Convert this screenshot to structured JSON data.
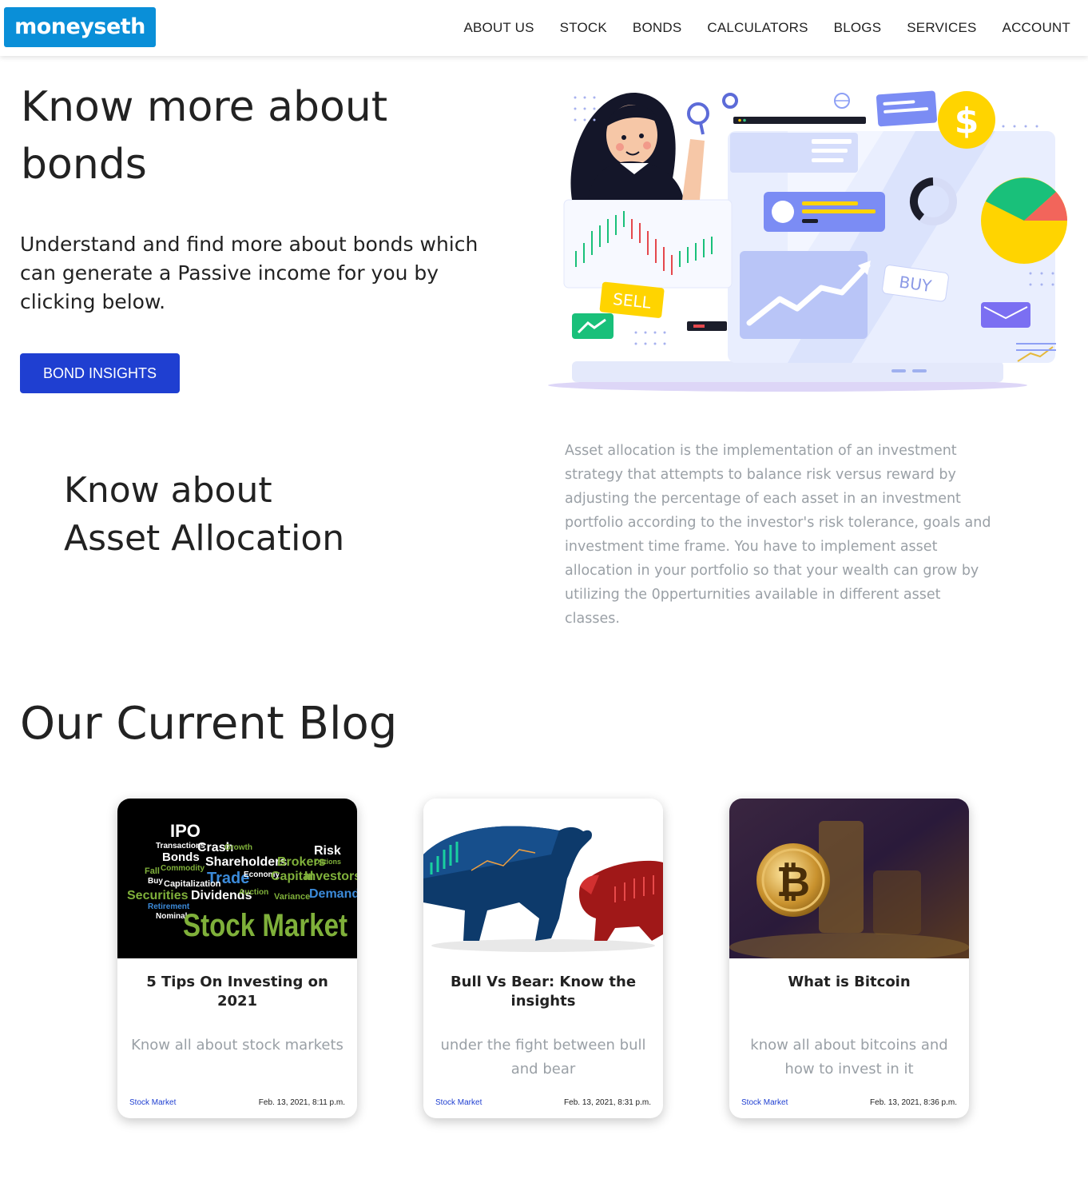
{
  "brand": {
    "logo_text": "moneyseth",
    "color": "#0a8fd8"
  },
  "nav": {
    "items": [
      {
        "label": "ABOUT US"
      },
      {
        "label": "STOCK"
      },
      {
        "label": "BONDS"
      },
      {
        "label": "CALCULATORS"
      },
      {
        "label": "BLOGS"
      },
      {
        "label": "SERVICES"
      },
      {
        "label": "ACCOUNT"
      }
    ]
  },
  "hero": {
    "title": "Know more about bonds",
    "subtitle": "Understand and find more about bonds which can generate a Passive income for you by clicking below.",
    "button_label": "BOND INSIGHTS",
    "button_color": "#1f3fd1",
    "illustration": {
      "sell_label": "SELL",
      "buy_label": "BUY",
      "dollar_symbol": "$"
    }
  },
  "asset_allocation": {
    "title_line1": "Know about",
    "title_line2": "Asset Allocation",
    "text": "Asset allocation is the implementation of an investment strategy that attempts to balance risk versus reward by adjusting the percentage of each asset in an investment portfolio according to the investor's risk tolerance, goals and investment time frame. You have to implement asset allocation in your portfolio so that your wealth can grow by utilizing the 0pperturnities available in different asset classes."
  },
  "blog": {
    "heading": "Our Current Blog",
    "posts": [
      {
        "title": "5 Tips On Investing on 2021",
        "description": "Know all about stock markets",
        "category": "Stock Market",
        "date": "Feb. 13, 2021, 8:11 p.m.",
        "image": {
          "words": [
            "IPO",
            "Transactions",
            "Crash",
            "Growth",
            "Risk",
            "Bonds",
            "Shareholders",
            "Brokers",
            "Options",
            "Fall",
            "Commodity",
            "Trade",
            "Economy",
            "Capital",
            "Investors",
            "Buy",
            "Capitalization",
            "Securities",
            "Dividends",
            "Auction",
            "Variance",
            "Demand",
            "Retirement",
            "Nominal",
            "Stock Market"
          ]
        }
      },
      {
        "title": "Bull Vs Bear: Know the insights",
        "description": "under the fight between bull and bear",
        "category": "Stock Market",
        "date": "Feb. 13, 2021, 8:31 p.m."
      },
      {
        "title": "What is Bitcoin",
        "description": "know all about bitcoins and how to invest in it",
        "category": "Stock Market",
        "date": "Feb. 13, 2021, 8:36 p.m.",
        "image": {
          "coin_symbol": "₿"
        }
      }
    ]
  }
}
